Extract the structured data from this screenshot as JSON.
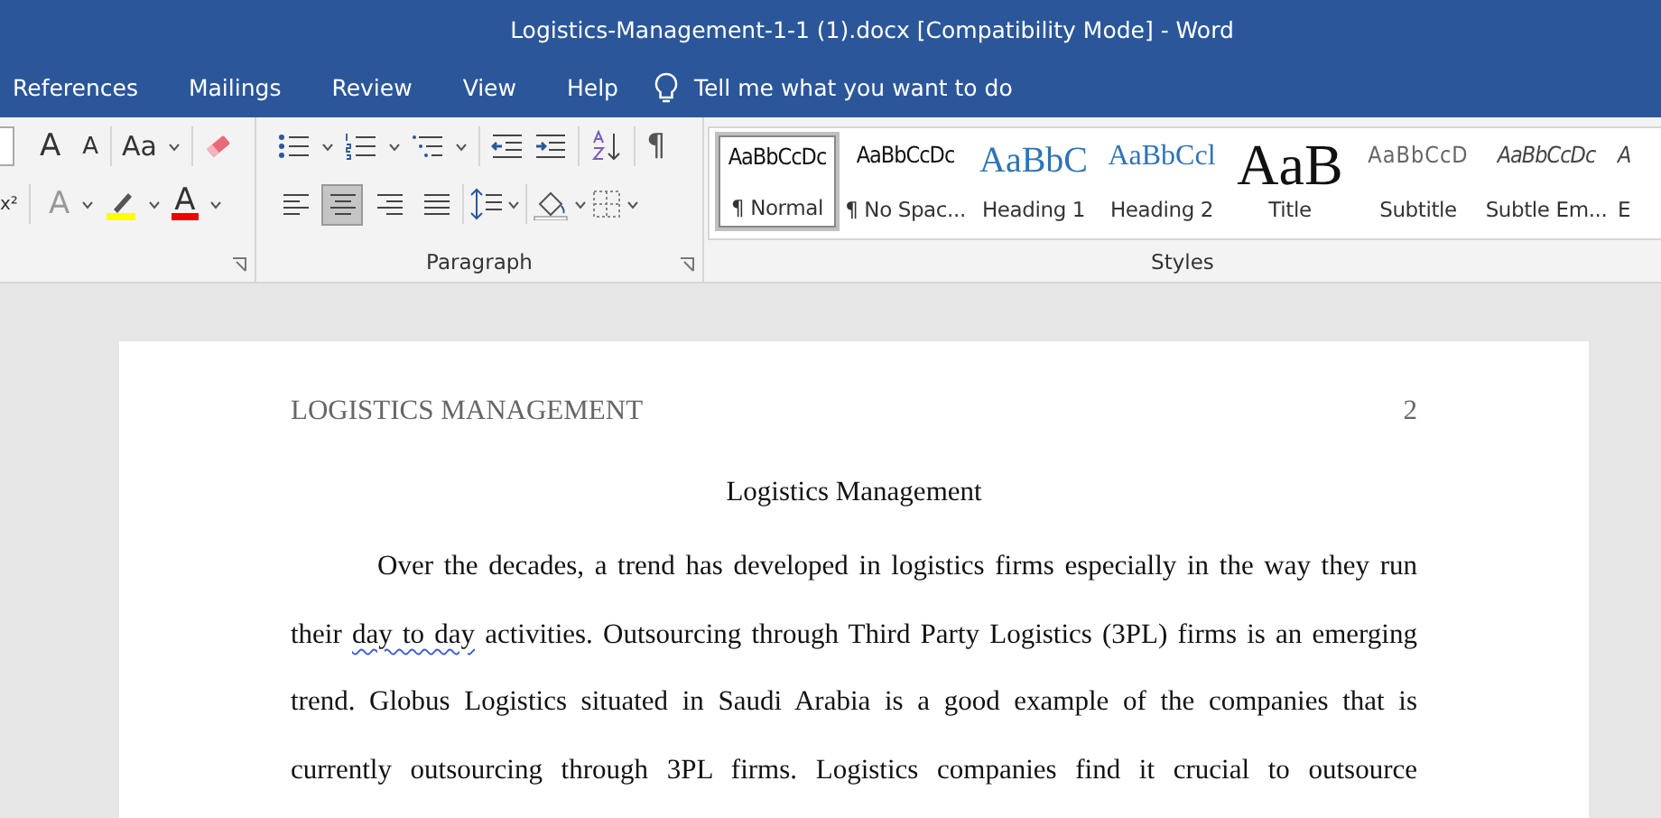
{
  "window": {
    "title": "Logistics-Management-1-1 (1).docx [Compatibility Mode]  -  Word"
  },
  "tabs": [
    {
      "label": "References",
      "selected": false
    },
    {
      "label": "Mailings",
      "selected": false
    },
    {
      "label": "Review",
      "selected": false
    },
    {
      "label": "View",
      "selected": false
    },
    {
      "label": "Help",
      "selected": false
    }
  ],
  "tell_me": {
    "placeholder": "Tell me what you want to do"
  },
  "font_group": {
    "grow": "A",
    "shrink": "A",
    "change_case": "Aa",
    "effects": "A",
    "font_color": "A",
    "superscript": "x²"
  },
  "paragraph_group": {
    "label": "Paragraph",
    "pilcrow": "¶",
    "alignments": [
      {
        "kind": "left",
        "selected": false
      },
      {
        "kind": "center",
        "selected": true
      },
      {
        "kind": "right",
        "selected": false
      },
      {
        "kind": "justify",
        "selected": false
      }
    ]
  },
  "styles_group": {
    "label": "Styles",
    "styles": [
      {
        "preview": "AaBbCcDc",
        "name": "¶ Normal",
        "kind": "normal",
        "selected": true
      },
      {
        "preview": "AaBbCcDc",
        "name": "¶ No Spac...",
        "kind": "normal",
        "selected": false
      },
      {
        "preview": "AaBbC",
        "name": "Heading 1",
        "kind": "heading1",
        "selected": false
      },
      {
        "preview": "AaBbCcl",
        "name": "Heading 2",
        "kind": "heading2",
        "selected": false
      },
      {
        "preview": "AaB",
        "name": "Title",
        "kind": "title",
        "selected": false
      },
      {
        "preview": "AaBbCcD",
        "name": "Subtitle",
        "kind": "subtitle",
        "selected": false
      },
      {
        "preview": "AaBbCcDc",
        "name": "Subtle Em...",
        "kind": "emphasis",
        "selected": false
      },
      {
        "preview": "A",
        "name": "E",
        "kind": "emphasis",
        "selected": false
      }
    ]
  },
  "document": {
    "header": "LOGISTICS MANAGEMENT",
    "page_number": "2",
    "title": "Logistics Management",
    "paragraph": [
      {
        "text": "Over the decades, a trend has developed in logistics firms especially in the way they run their ",
        "flagged": false
      },
      {
        "text": "day to day",
        "flagged": true
      },
      {
        "text": " activities. Outsourcing through Third Party Logistics (3PL) firms is an emerging trend. Globus Logistics situated in Saudi Arabia is a good example of the companies that is currently outsourcing through 3PL firms. Logistics companies find it crucial to outsource",
        "flagged": false
      }
    ]
  }
}
